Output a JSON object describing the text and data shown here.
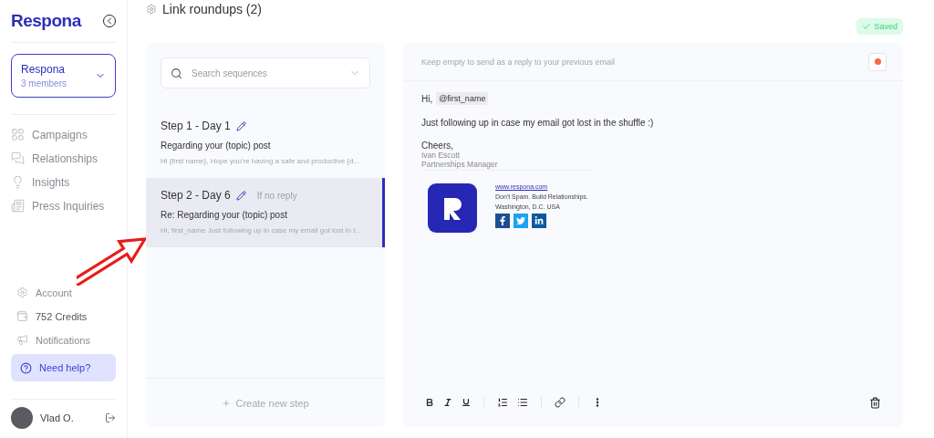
{
  "sidebar": {
    "logo": "Respona",
    "workspace": {
      "name": "Respona",
      "members": "3 members"
    },
    "nav": [
      {
        "label": "Campaigns"
      },
      {
        "label": "Relationships"
      },
      {
        "label": "Insights"
      },
      {
        "label": "Press Inquiries"
      }
    ],
    "bottom": [
      {
        "label": "Account"
      },
      {
        "label": "752 Credits"
      },
      {
        "label": "Notifications"
      }
    ],
    "help": "Need help?",
    "user": {
      "name": "Vlad O."
    }
  },
  "page_title": "Link roundups (2)",
  "status": "Saved",
  "steps_panel": {
    "search": {
      "placeholder": "Search sequences"
    },
    "steps": [
      {
        "title": "Step 1 - Day 1",
        "subject": "Regarding your (topic) post",
        "preview": "Hi {first name}, Hope you're having a safe and productive {d...",
        "selected": false
      },
      {
        "title": "Step 2 - Day 6",
        "condition": "If no reply",
        "subject": "Re: Regarding your (topic) post",
        "preview": "Hi, first_name Just following up in case my email got lost in t...",
        "selected": true
      }
    ],
    "create_step": "Create new step"
  },
  "editor": {
    "subject": {
      "placeholder": "Keep empty to send as a reply to your previous email"
    },
    "greeting": "Hi,",
    "variable": "@first_name",
    "body": "Just following up in case my email got lost in the shuffle :)",
    "signoff": "Cheers,",
    "sender": "Ivan Escott",
    "role": "Partnerships Manager",
    "signature": {
      "link": "www.respona.com",
      "tagline": "Don't Spam. Build Relationships.",
      "location": "Washington, D.C. USA"
    }
  }
}
